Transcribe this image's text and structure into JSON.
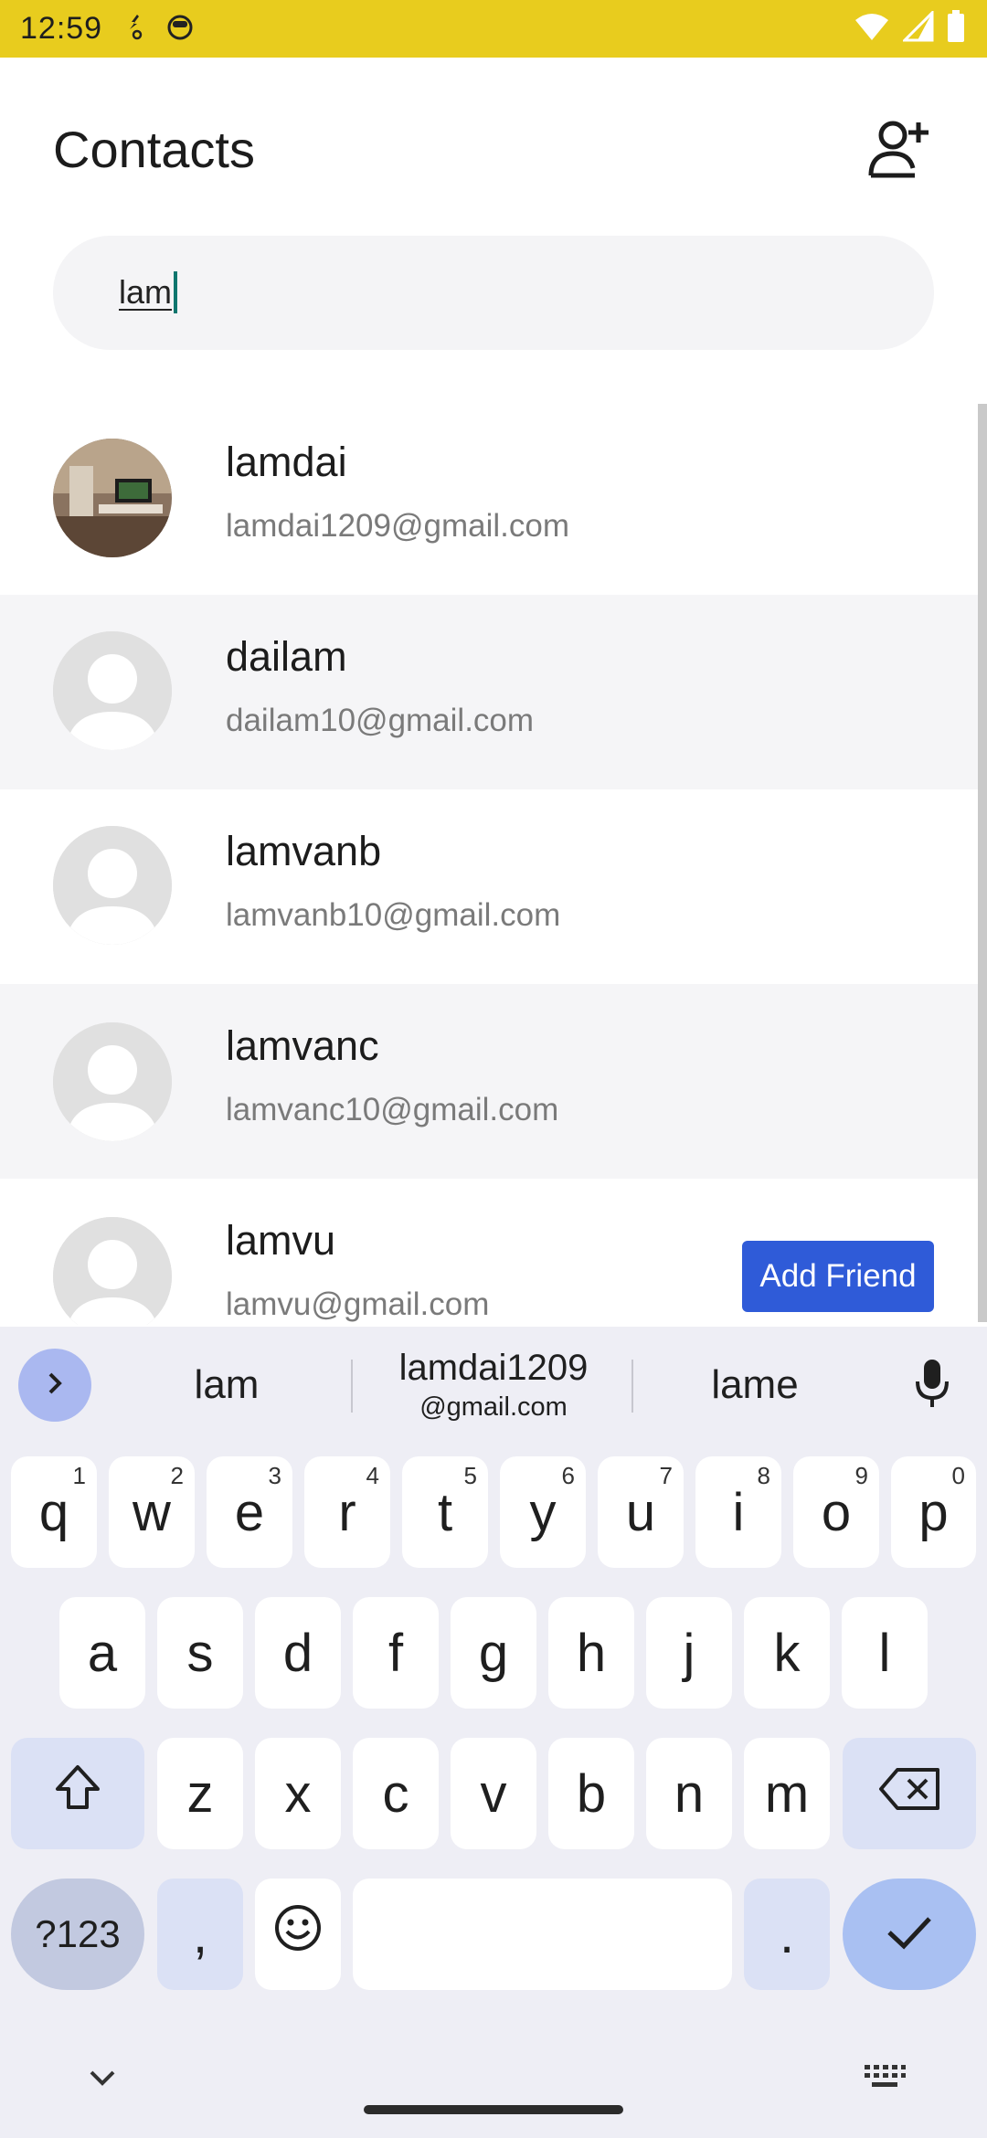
{
  "status_bar": {
    "time": "12:59",
    "icons_left": [
      "sync-icon",
      "cat-face-icon"
    ],
    "icons_right": [
      "wifi-icon",
      "signal-icon",
      "battery-icon"
    ],
    "background": "#e8cc1e"
  },
  "header": {
    "title": "Contacts",
    "add_contact_icon": "person-add-icon"
  },
  "search": {
    "value": "lam"
  },
  "contacts": [
    {
      "name": "lamdai",
      "email": "lamdai1209@gmail.com",
      "avatar": "photo"
    },
    {
      "name": "dailam",
      "email": "dailam10@gmail.com",
      "avatar": "default"
    },
    {
      "name": "lamvanb",
      "email": "lamvanb10@gmail.com",
      "avatar": "default"
    },
    {
      "name": "lamvanc",
      "email": "lamvanc10@gmail.com",
      "avatar": "default"
    },
    {
      "name": "lamvu",
      "email": "lamvu@gmail.com",
      "avatar": "default",
      "action": "Add Friend"
    }
  ],
  "keyboard": {
    "suggestions": [
      "lam",
      "lamdai1209",
      "@gmail.com",
      "lame"
    ],
    "row1": [
      "q",
      "w",
      "e",
      "r",
      "t",
      "y",
      "u",
      "i",
      "o",
      "p"
    ],
    "row1_hints": [
      "1",
      "2",
      "3",
      "4",
      "5",
      "6",
      "7",
      "8",
      "9",
      "0"
    ],
    "row2": [
      "a",
      "s",
      "d",
      "f",
      "g",
      "h",
      "j",
      "k",
      "l"
    ],
    "row3": [
      "z",
      "x",
      "c",
      "v",
      "b",
      "n",
      "m"
    ],
    "symbols_label": "?123",
    "comma": ",",
    "period": ".",
    "accent": "#2f5bd8"
  }
}
